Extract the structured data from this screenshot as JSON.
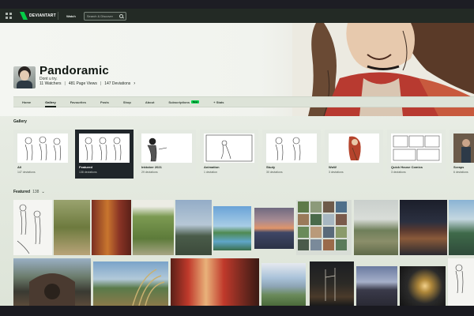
{
  "navbar": {
    "logo_text": "DEVIANTART",
    "link": "Watch",
    "search_placeholder": "Search & Discover"
  },
  "profile": {
    "username": "Pandoramic",
    "tagline": "Dont u try.",
    "watchers": "11 Watchers",
    "page_views": "481 Page Views",
    "deviations": "147 Deviations"
  },
  "tabs": [
    {
      "label": "Home"
    },
    {
      "label": "Gallery"
    },
    {
      "label": "Favourites"
    },
    {
      "label": "Posts"
    },
    {
      "label": "Shop"
    },
    {
      "label": "About"
    },
    {
      "label": "Subscriptions",
      "badge": "New"
    },
    {
      "label": "+ Stats"
    }
  ],
  "gallery": {
    "title": "Gallery",
    "folders": [
      {
        "name": "All",
        "count": "147 deviations"
      },
      {
        "name": "Featured",
        "count": "138 deviations"
      },
      {
        "name": "Inktober 2021",
        "count": "29 deviations"
      },
      {
        "name": "Animation",
        "count": "1 deviation"
      },
      {
        "name": "Study",
        "count": "30 deviations"
      },
      {
        "name": "WoW",
        "count": "3 deviations"
      },
      {
        "name": "Quick House Comics",
        "count": "3 deviations"
      },
      {
        "name": "Scraps",
        "count": "6 deviations"
      }
    ]
  },
  "featured": {
    "label": "Featured",
    "count": "138"
  },
  "colors": {
    "accent_green": "#05cc47",
    "navbar": "#232a25",
    "selected_card": "#20262a"
  }
}
